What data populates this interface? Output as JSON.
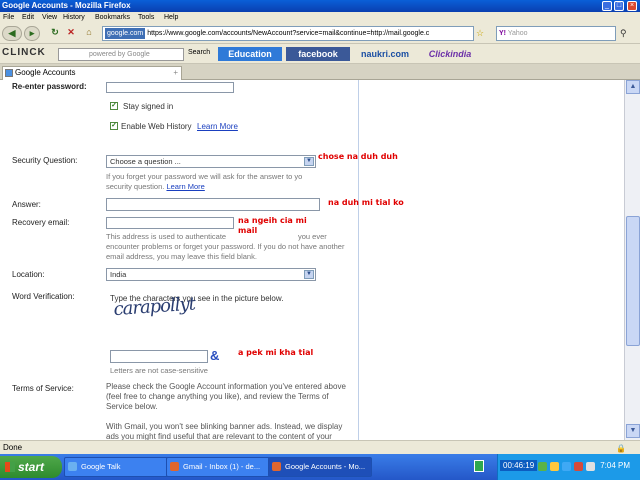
{
  "window": {
    "title": "Google Accounts - Mozilla Firefox"
  },
  "menu": [
    "File",
    "Edit",
    "View",
    "History",
    "Bookmarks",
    "Tools",
    "Help"
  ],
  "nav": {
    "site_identity": "google.com",
    "url": "https://www.google.com/accounts/NewAccount?service=mail&continue=http://mail.google.c",
    "search_placeholder": "Yahoo"
  },
  "toolbar": {
    "brand": "CLINCK",
    "search_placeholder": "powered by Google",
    "search_label": "Search",
    "buttons": [
      "Education",
      "facebook",
      "naukri.com",
      "Clickindia"
    ]
  },
  "tab": {
    "title": "Google Accounts"
  },
  "form": {
    "reenter_password_label": "Re-enter password:",
    "stay_signed_in": "Stay signed in",
    "web_history": "Enable Web History",
    "learn_more": "Learn More",
    "security_question_label": "Security Question:",
    "security_question_value": "Choose a question ...",
    "security_help": "If you forget your password we will ask for the answer to yo security question.",
    "answer_label": "Answer:",
    "recovery_email_label": "Recovery email:",
    "recovery_help_1": "This address is used to authenticate",
    "recovery_help_2": "you ever",
    "recovery_help_3": "encounter problems or forget your password. If you do not have another email address, you may leave this field blank.",
    "location_label": "Location:",
    "location_value": "India",
    "word_verification_label": "Word Verification:",
    "word_verification_text": "Type the characters you see in the picture below.",
    "captcha_text": "carapollyt",
    "case_sensitive": "Letters are not case-sensitive",
    "terms_label": "Terms of Service:",
    "terms_text": "Please check the Google Account information you've entered above (feel free to change anything you like), and review the Terms of Service below.",
    "gmail_text": "With Gmail, you won't see blinking banner ads. Instead, we display ads you might find useful that are relevant to the content of your"
  },
  "annotations": {
    "note_security": "chose na duh duh",
    "note_answer": "na duh mi tial ko",
    "note_email_1": "na ngeih cia mi",
    "note_email_2": "mail",
    "note_captcha": "a pek mi kha tial"
  },
  "status": {
    "text": "Done"
  },
  "taskbar": {
    "start": "start",
    "tasks": [
      "Google Talk",
      "Gmail - Inbox (1) - de...",
      "Google Accounts - Mo..."
    ],
    "timer": "00:46:19",
    "clock": "7:04 PM"
  }
}
